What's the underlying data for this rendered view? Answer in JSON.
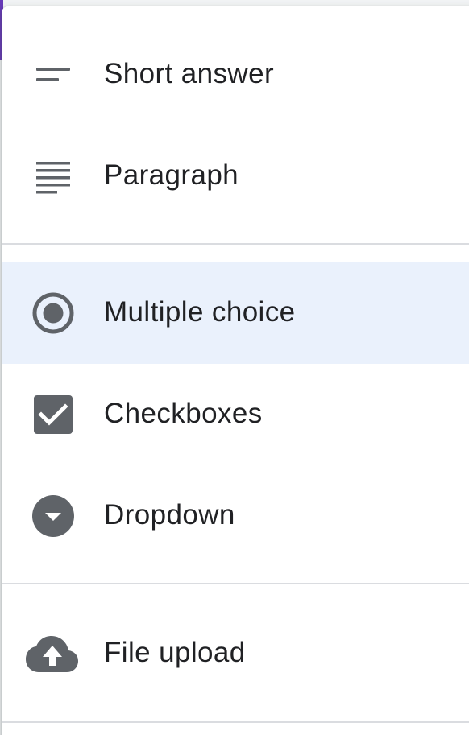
{
  "menu": {
    "items": [
      {
        "label": "Short answer",
        "icon": "short-answer-icon"
      },
      {
        "label": "Paragraph",
        "icon": "paragraph-icon"
      },
      {
        "label": "Multiple choice",
        "icon": "radio-button-icon",
        "selected": true
      },
      {
        "label": "Checkboxes",
        "icon": "checkbox-icon"
      },
      {
        "label": "Dropdown",
        "icon": "dropdown-icon"
      },
      {
        "label": "File upload",
        "icon": "cloud-upload-icon"
      }
    ]
  },
  "colors": {
    "icon": "#5f6368",
    "text": "#202124",
    "selected_bg": "#eaf1fc",
    "divider": "#dadce0",
    "accent": "#673ab7"
  }
}
